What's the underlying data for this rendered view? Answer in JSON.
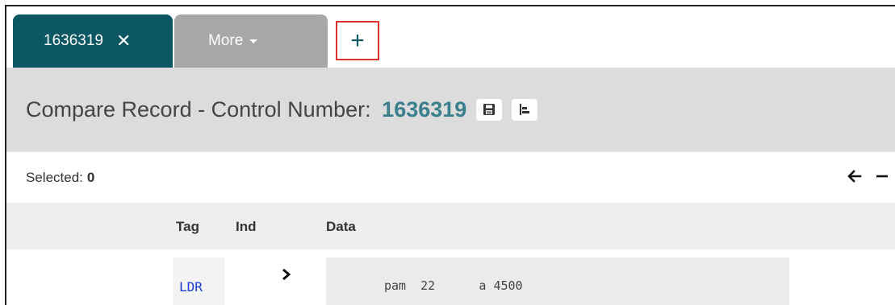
{
  "tabs": {
    "active_label": "1636319",
    "more_label": "More"
  },
  "header": {
    "title_prefix": "Compare Record - Control Number:",
    "control_number": "1636319"
  },
  "selection": {
    "label": "Selected:",
    "count": "0"
  },
  "table": {
    "headers": {
      "tag": "Tag",
      "ind": "Ind",
      "data": "Data"
    },
    "rows": [
      {
        "tag": "LDR",
        "data": "pam  22      a 4500"
      }
    ]
  },
  "icons": [
    "close-icon",
    "caret-down-icon",
    "plus-icon",
    "save-icon",
    "align-left-icon",
    "arrow-left-icon",
    "minus-icon",
    "chevron-right-icon"
  ],
  "colors": {
    "tab_active": "#0b5763",
    "tab_inactive": "#a7a7a7",
    "highlight": "#e03131",
    "control_number": "#3a7f8c",
    "tag_text": "#1a3bcf"
  }
}
